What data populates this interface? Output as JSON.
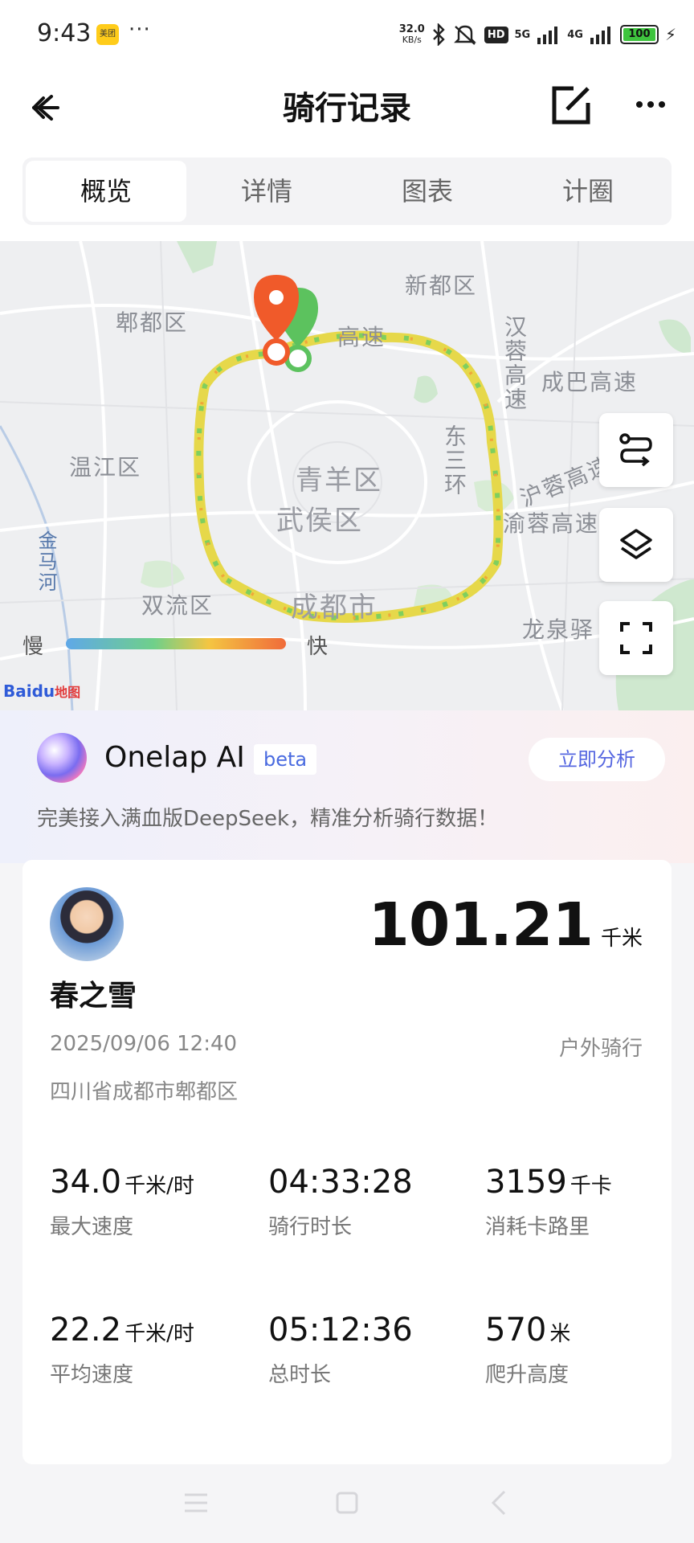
{
  "status_bar": {
    "time": "9:43",
    "app_badge": "美团",
    "more": "···",
    "net_speed": "32.0",
    "net_speed_unit": "KB/s",
    "hd_badge": "HD",
    "signal_1": "5G",
    "signal_2": "4G",
    "battery": "100"
  },
  "header": {
    "title": "骑行记录"
  },
  "tabs": [
    "概览",
    "详情",
    "图表",
    "计圈"
  ],
  "map": {
    "labels": {
      "xindu": "新都区",
      "pidu": "郫都区",
      "chengba": "成巴高速",
      "hanrong": "汉蓉高速",
      "wenjiang": "温江区",
      "qingyang": "青羊区",
      "wuhou": "武侯区",
      "dong_san_huan": "东三环",
      "hurong": "沪蓉高速",
      "yurong": "渝蓉高速",
      "jinma": "金马河",
      "shuangliu": "双流区",
      "chengdu": "成都市",
      "longquan": "龙泉驿",
      "gaosu": "高速"
    },
    "legend_slow": "慢",
    "legend_fast": "快",
    "attribution": "Bai",
    "attribution_du": "du",
    "attribution_tail": "地图"
  },
  "ai": {
    "name": "Onelap AI",
    "badge": "beta",
    "button": "立即分析",
    "description": "完美接入满血版DeepSeek，精准分析骑行数据！"
  },
  "record": {
    "distance": "101.21",
    "distance_unit": "千米",
    "username": "春之雪",
    "datetime": "2025/09/06 12:40",
    "activity_type": "户外骑行",
    "location": "四川省成都市郫都区",
    "stats": [
      {
        "value": "34.0",
        "unit": "千米/时",
        "label": "最大速度"
      },
      {
        "value": "04:33:28",
        "unit": "",
        "label": "骑行时长"
      },
      {
        "value": "3159",
        "unit": "千卡",
        "label": "消耗卡路里"
      },
      {
        "value": "22.2",
        "unit": "千米/时",
        "label": "平均速度"
      },
      {
        "value": "05:12:36",
        "unit": "",
        "label": "总时长"
      },
      {
        "value": "570",
        "unit": "米",
        "label": "爬升高度"
      }
    ]
  },
  "colors": {
    "accent": "#4a6be0",
    "route_yellow": "#e6d84a",
    "route_green": "#7fcf5e",
    "start_marker": "#5cc25e",
    "end_marker": "#f05a2a"
  }
}
